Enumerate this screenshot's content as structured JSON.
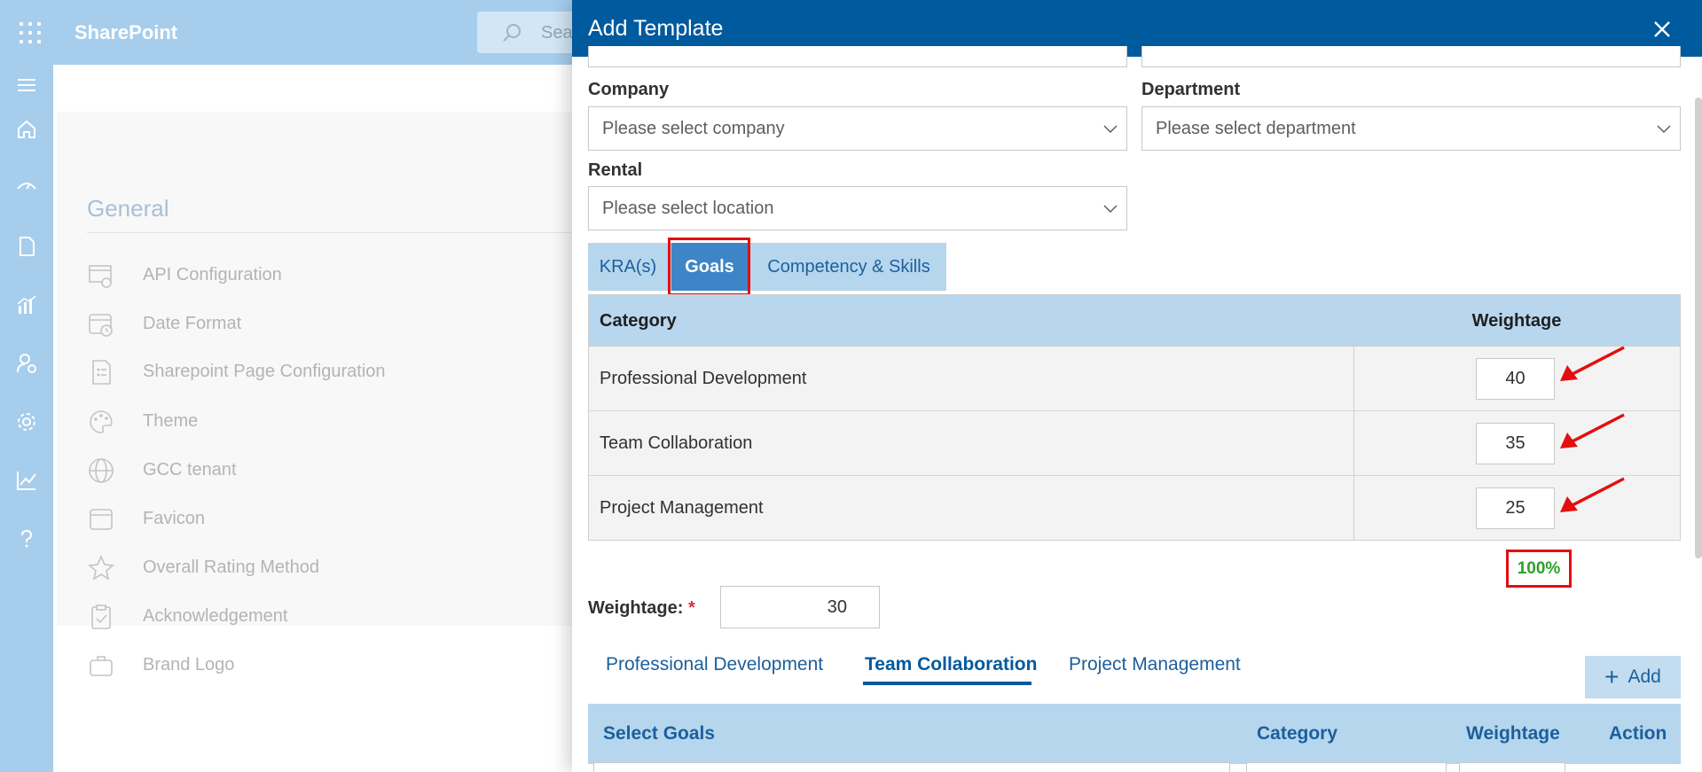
{
  "app": {
    "brand": "SharePoint",
    "search_placeholder": "Sea"
  },
  "nav": {
    "icons": [
      "menu-icon",
      "home-icon",
      "speed-icon",
      "document-icon",
      "chart-icon",
      "user-settings-icon",
      "gear-icon",
      "trend-icon",
      "help-icon"
    ]
  },
  "general": {
    "title": "General",
    "items": [
      {
        "label": "API Configuration",
        "icon": "api-config-icon"
      },
      {
        "label": "Date Format",
        "icon": "calendar-clock-icon"
      },
      {
        "label": "Sharepoint Page Configuration",
        "icon": "page-config-icon"
      },
      {
        "label": "Theme",
        "icon": "palette-icon"
      },
      {
        "label": "GCC tenant",
        "icon": "globe-icon"
      },
      {
        "label": "Favicon",
        "icon": "window-icon"
      },
      {
        "label": "Overall Rating Method",
        "icon": "star-icon"
      },
      {
        "label": "Acknowledgement",
        "icon": "clipboard-check-icon"
      },
      {
        "label": "Brand Logo",
        "icon": "briefcase-icon"
      }
    ]
  },
  "panel": {
    "title": "Add Template",
    "company": {
      "label": "Company",
      "placeholder": "Please select company"
    },
    "department": {
      "label": "Department",
      "placeholder": "Please select department"
    },
    "rental": {
      "label": "Rental",
      "placeholder": "Please select location"
    },
    "tabs": [
      "KRA(s)",
      "Goals",
      "Competency & Skills"
    ],
    "active_tab": "Goals",
    "table": {
      "headers": [
        "Category",
        "Weightage"
      ],
      "rows": [
        {
          "category": "Professional Development",
          "weightage": "40"
        },
        {
          "category": "Team Collaboration",
          "weightage": "35"
        },
        {
          "category": "Project Management",
          "weightage": "25"
        }
      ],
      "total": "100%"
    },
    "weightage": {
      "label": "Weightage:",
      "required_mark": "*",
      "value": "30"
    },
    "goal_tabs": [
      "Professional Development",
      "Team Collaboration",
      "Project Management"
    ],
    "active_goal_tab": "Team Collaboration",
    "add_button": "Add",
    "goals_table_headers": [
      "Select Goals",
      "Category",
      "Weightage",
      "Action"
    ]
  },
  "colors": {
    "header": "#005a9e",
    "accent": "#3d85c6",
    "highlight": "#e30f0f",
    "success": "#2aa12a"
  }
}
